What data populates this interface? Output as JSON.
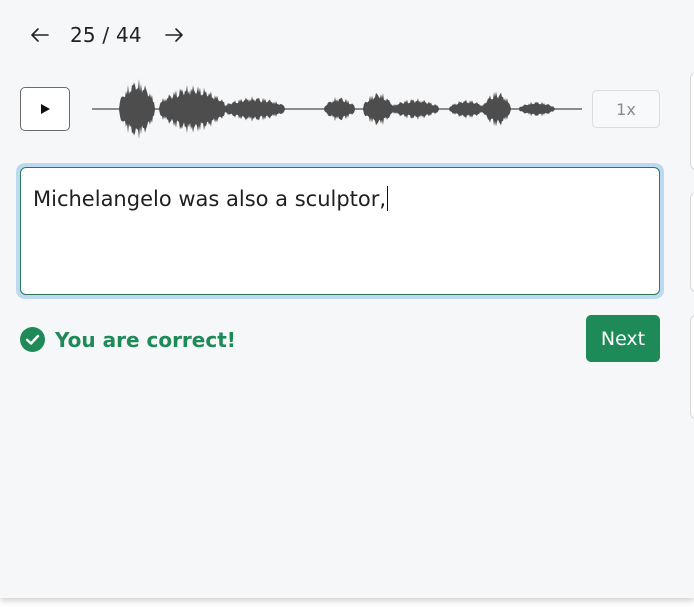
{
  "pager": {
    "prev_icon": "arrow-left-icon",
    "current": "25",
    "separator": "/",
    "total": "44",
    "next_icon": "arrow-right-icon"
  },
  "player": {
    "play_icon": "play-icon",
    "speed_label": "1x"
  },
  "answer": {
    "text": "Michelangelo was also a sculptor,"
  },
  "feedback": {
    "icon": "check-circle-icon",
    "message": "You are correct!",
    "color": "#1e8a57"
  },
  "actions": {
    "next_label": "Next"
  },
  "colors": {
    "accent": "#1e8a57",
    "focus_ring": "#bcd9f0",
    "waveform": "#4d4d4d"
  }
}
